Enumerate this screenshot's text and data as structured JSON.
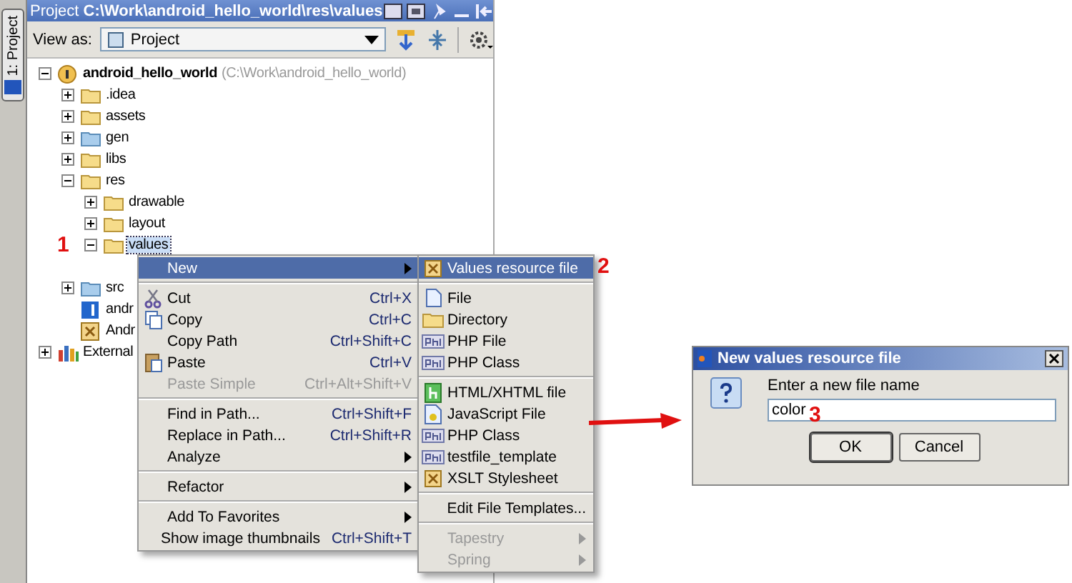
{
  "side_tab": {
    "label": "1: Project",
    "selected": true
  },
  "panel": {
    "title_prefix": "Project",
    "title_path": "C:\\Work\\android_hello_world\\res\\values"
  },
  "toolbar": {
    "view_as_label": "View as:",
    "view_as_value": "Project"
  },
  "tree": [
    {
      "label": "android_hello_world",
      "note": "(C:\\Work\\android_hello_world)",
      "kind": "module",
      "expanded": true,
      "selected": false,
      "children": [
        {
          "label": ".idea",
          "kind": "folder",
          "expanded": false,
          "selected": false
        },
        {
          "label": "assets",
          "kind": "folder",
          "expanded": false,
          "selected": false
        },
        {
          "label": "gen",
          "kind": "sourcefolder",
          "expanded": false,
          "selected": false
        },
        {
          "label": "libs",
          "kind": "folder",
          "expanded": false,
          "selected": false
        },
        {
          "label": "res",
          "kind": "folder",
          "expanded": true,
          "selected": false,
          "children": [
            {
              "label": "drawable",
              "kind": "folder",
              "expanded": false,
              "selected": false
            },
            {
              "label": "layout",
              "kind": "folder",
              "expanded": false,
              "selected": false
            },
            {
              "label": "values",
              "kind": "folder",
              "expanded": true,
              "selected": true
            }
          ]
        },
        {
          "label": "src",
          "kind": "sourcefolder",
          "expanded": false,
          "selected": false
        },
        {
          "label": "andr",
          "kind": "ideafile",
          "selected": false
        },
        {
          "label": "Andr",
          "kind": "xmlfile",
          "selected": false
        }
      ]
    },
    {
      "label": "External",
      "kind": "library",
      "expanded": false,
      "selected": false
    }
  ],
  "context_menu": [
    {
      "kind": "plain",
      "label": "New",
      "submenu": true,
      "selected": true,
      "disabled": false
    },
    {
      "kind": "separator"
    },
    {
      "kind": "cut",
      "label": "Cut",
      "shortcut": "Ctrl+X",
      "selected": false,
      "disabled": false
    },
    {
      "kind": "copy",
      "label": "Copy",
      "shortcut": "Ctrl+C",
      "selected": false,
      "disabled": false
    },
    {
      "kind": "plain",
      "label": "Copy Path",
      "shortcut": "Ctrl+Shift+C",
      "selected": false,
      "disabled": false
    },
    {
      "kind": "paste",
      "label": "Paste",
      "shortcut": "Ctrl+V",
      "selected": false,
      "disabled": false
    },
    {
      "kind": "plain",
      "label": "Paste Simple",
      "shortcut": "Ctrl+Alt+Shift+V",
      "selected": false,
      "disabled": true
    },
    {
      "kind": "separator"
    },
    {
      "kind": "plain",
      "label": "Find in Path...",
      "shortcut": "Ctrl+Shift+F",
      "selected": false,
      "disabled": false
    },
    {
      "kind": "plain",
      "label": "Replace in Path...",
      "shortcut": "Ctrl+Shift+R",
      "selected": false,
      "disabled": false
    },
    {
      "kind": "plain",
      "label": "Analyze",
      "submenu": true,
      "selected": false,
      "disabled": false
    },
    {
      "kind": "separator"
    },
    {
      "kind": "plain",
      "label": "Refactor",
      "submenu": true,
      "selected": false,
      "disabled": false
    },
    {
      "kind": "separator"
    },
    {
      "kind": "plain",
      "label": "Add To Favorites",
      "submenu": true,
      "selected": false,
      "disabled": false
    },
    {
      "kind": "plain",
      "label": "Show image thumbnails",
      "shortcut": "Ctrl+Shift+T",
      "selected": false,
      "disabled": false
    }
  ],
  "submenu": [
    {
      "kind": "xml",
      "label": "Values resource file",
      "selected": true,
      "disabled": false
    },
    {
      "kind": "separator"
    },
    {
      "kind": "file",
      "label": "File",
      "selected": false,
      "disabled": false
    },
    {
      "kind": "folder",
      "label": "Directory",
      "selected": false,
      "disabled": false
    },
    {
      "kind": "php",
      "label": "PHP File",
      "selected": false,
      "disabled": false
    },
    {
      "kind": "php",
      "label": "PHP Class",
      "selected": false,
      "disabled": false
    },
    {
      "kind": "separator"
    },
    {
      "kind": "html",
      "label": "HTML/XHTML file",
      "selected": false,
      "disabled": false
    },
    {
      "kind": "js",
      "label": "JavaScript File",
      "selected": false,
      "disabled": false
    },
    {
      "kind": "php",
      "label": "PHP Class",
      "selected": false,
      "disabled": false
    },
    {
      "kind": "php",
      "label": "testfile_template",
      "selected": false,
      "disabled": false
    },
    {
      "kind": "xml",
      "label": "XSLT Stylesheet",
      "selected": false,
      "disabled": false
    },
    {
      "kind": "separator"
    },
    {
      "kind": "plain",
      "label": "Edit File Templates...",
      "selected": false,
      "disabled": false
    },
    {
      "kind": "separator"
    },
    {
      "kind": "plain",
      "label": "Tapestry",
      "submenu": true,
      "selected": false,
      "disabled": true
    },
    {
      "kind": "plain",
      "label": "Spring",
      "submenu": true,
      "selected": false,
      "disabled": true
    }
  ],
  "dialog": {
    "title": "New values resource file",
    "prompt": "Enter a new file name",
    "value": "color",
    "buttons": [
      "OK",
      "Cancel"
    ]
  },
  "markers": [
    "1",
    "2",
    "3"
  ]
}
